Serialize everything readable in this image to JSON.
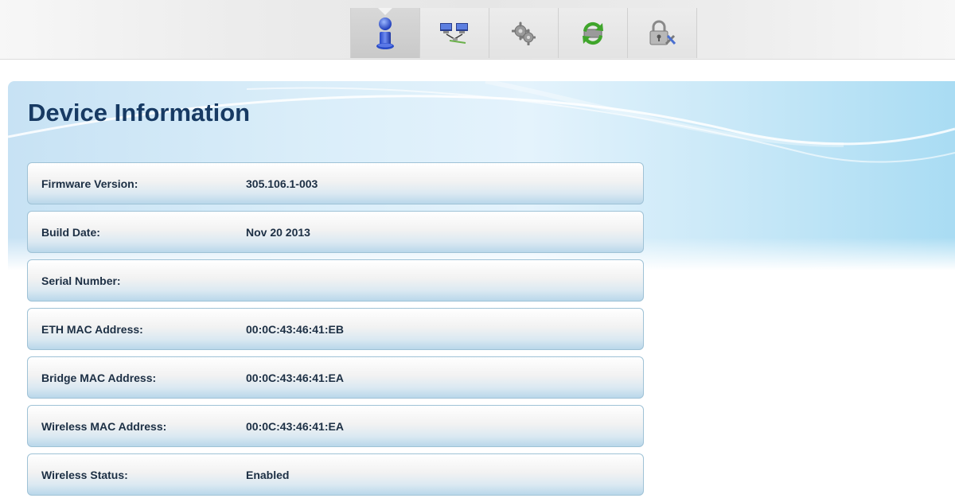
{
  "toolbar": {
    "tabs": [
      {
        "icon": "info-person-icon",
        "active": true
      },
      {
        "icon": "network-computers-icon",
        "active": false
      },
      {
        "icon": "gears-icon",
        "active": false
      },
      {
        "icon": "update-arrows-icon",
        "active": false
      },
      {
        "icon": "padlock-tools-icon",
        "active": false
      }
    ]
  },
  "page": {
    "title": "Device Information"
  },
  "device_info": [
    {
      "label": "Firmware Version:",
      "value": "305.106.1-003"
    },
    {
      "label": "Build Date:",
      "value": "Nov 20 2013"
    },
    {
      "label": "Serial Number:",
      "value": ""
    },
    {
      "label": "ETH MAC Address:",
      "value": "00:0C:43:46:41:EB"
    },
    {
      "label": "Bridge MAC Address:",
      "value": "00:0C:43:46:41:EA"
    },
    {
      "label": "Wireless MAC Address:",
      "value": "00:0C:43:46:41:EA"
    },
    {
      "label": "Wireless Status:",
      "value": "Enabled"
    }
  ],
  "colors": {
    "title": "#173a63",
    "row_border": "#9fc2d6",
    "panel_blue": "#a9dcf3"
  }
}
